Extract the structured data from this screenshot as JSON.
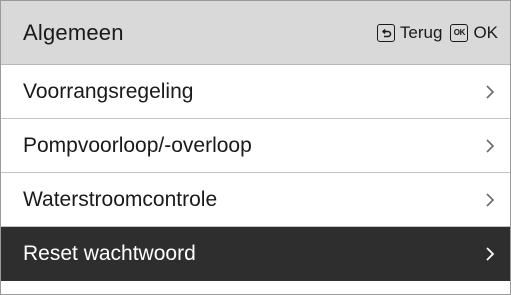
{
  "header": {
    "title": "Algemeen",
    "back_label": "Terug",
    "ok_key_label": "OK",
    "ok_label": "OK"
  },
  "menu": {
    "items": [
      {
        "label": "Voorrangsregeling",
        "selected": false
      },
      {
        "label": "Pompvoorloop/-overloop",
        "selected": false
      },
      {
        "label": "Waterstroomcontrole",
        "selected": false
      },
      {
        "label": "Reset wachtwoord",
        "selected": true
      }
    ]
  },
  "colors": {
    "header_bg": "#d9d9d9",
    "selected_bg": "#2e2e2e",
    "selected_text": "#ffffff"
  },
  "icons": {
    "back": "back-key-icon",
    "ok": "ok-key-icon",
    "chevron": "chevron-right-icon"
  }
}
